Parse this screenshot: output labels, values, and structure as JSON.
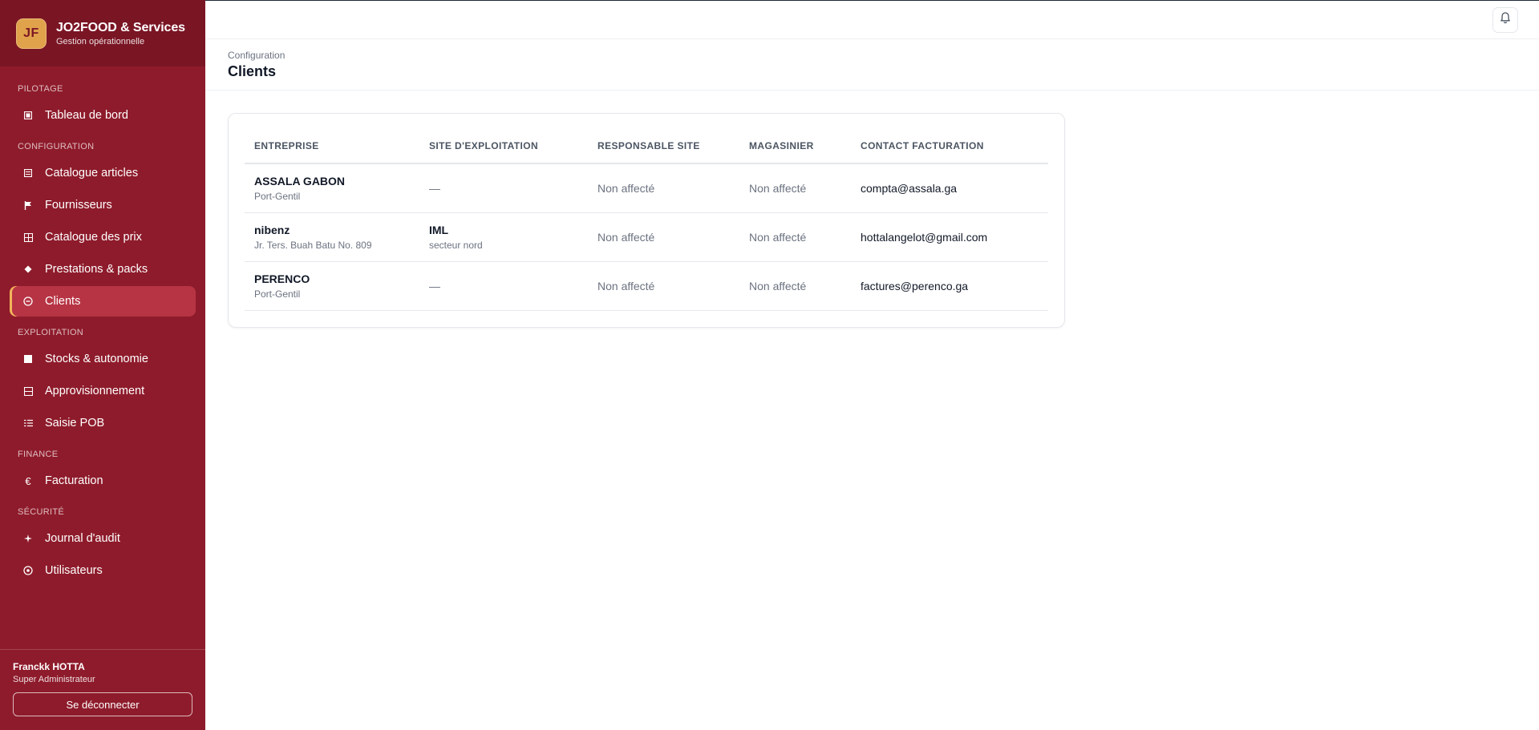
{
  "brand": {
    "logo_text": "JF",
    "title": "JO2FOOD & Services",
    "subtitle": "Gestion opérationnelle",
    "accent": "#e0a24b",
    "sidebar_bg": "#8e1b2b"
  },
  "nav": {
    "sections": [
      {
        "label": "PILOTAGE",
        "items": [
          {
            "label": "Tableau de bord",
            "icon": "dashboard-icon"
          }
        ]
      },
      {
        "label": "CONFIGURATION",
        "items": [
          {
            "label": "Catalogue articles",
            "icon": "catalog-icon"
          },
          {
            "label": "Fournisseurs",
            "icon": "flag-icon"
          },
          {
            "label": "Catalogue des prix",
            "icon": "grid-icon"
          },
          {
            "label": "Prestations & packs",
            "icon": "diamond-icon"
          },
          {
            "label": "Clients",
            "icon": "clients-icon",
            "active": true
          }
        ]
      },
      {
        "label": "EXPLOITATION",
        "items": [
          {
            "label": "Stocks & autonomie",
            "icon": "stock-icon"
          },
          {
            "label": "Approvisionnement",
            "icon": "supply-icon"
          },
          {
            "label": "Saisie POB",
            "icon": "list-icon"
          }
        ]
      },
      {
        "label": "FINANCE",
        "items": [
          {
            "label": "Facturation",
            "icon": "euro-icon"
          }
        ]
      },
      {
        "label": "SÉCURITÉ",
        "items": [
          {
            "label": "Journal d'audit",
            "icon": "sparkle-icon"
          },
          {
            "label": "Utilisateurs",
            "icon": "users-icon"
          }
        ]
      }
    ]
  },
  "user": {
    "name": "Franckk HOTTA",
    "role": "Super Administrateur",
    "logout_label": "Se déconnecter"
  },
  "header": {
    "breadcrumb": "Configuration",
    "title": "Clients"
  },
  "table": {
    "columns": [
      "ENTREPRISE",
      "SITE D'EXPLOITATION",
      "RESPONSABLE SITE",
      "MAGASINIER",
      "CONTACT FACTURATION"
    ],
    "rows": [
      {
        "company": "ASSALA GABON",
        "company_sub": "Port-Gentil",
        "site": "—",
        "site_sub": "",
        "manager": "Non affecté",
        "storekeeper": "Non affecté",
        "contact": "compta@assala.ga"
      },
      {
        "company": "nibenz",
        "company_sub": "Jr. Ters. Buah Batu No. 809",
        "site": "IML",
        "site_sub": "secteur nord",
        "manager": "Non affecté",
        "storekeeper": "Non affecté",
        "contact": "hottalangelot@gmail.com"
      },
      {
        "company": "PERENCO",
        "company_sub": "Port-Gentil",
        "site": "—",
        "site_sub": "",
        "manager": "Non affecté",
        "storekeeper": "Non affecté",
        "contact": "factures@perenco.ga"
      }
    ]
  }
}
